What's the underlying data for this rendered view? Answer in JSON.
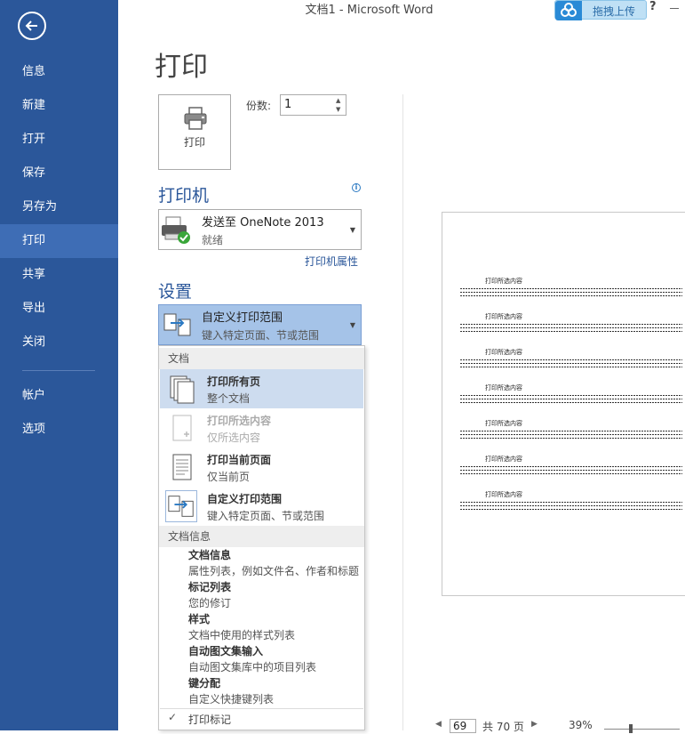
{
  "window": {
    "title": "文档1 - Microsoft Word",
    "upload_label": "拖拽上传",
    "help": "?"
  },
  "sidebar": {
    "items": [
      {
        "label": "信息"
      },
      {
        "label": "新建"
      },
      {
        "label": "打开"
      },
      {
        "label": "保存"
      },
      {
        "label": "另存为"
      },
      {
        "label": "打印",
        "active": true
      },
      {
        "label": "共享"
      },
      {
        "label": "导出"
      },
      {
        "label": "关闭"
      },
      {
        "label": "帐户"
      },
      {
        "label": "选项"
      }
    ]
  },
  "print": {
    "heading": "打印",
    "print_button": "打印",
    "copies_label": "份数:",
    "copies_value": "1"
  },
  "printer": {
    "heading": "打印机",
    "name": "发送至 OneNote 2013",
    "status": "就绪",
    "properties_link": "打印机属性"
  },
  "settings": {
    "heading": "设置",
    "selected_title": "自定义打印范围",
    "selected_sub": "键入特定页面、节或范围"
  },
  "dropdown": {
    "section1": "文档",
    "options": [
      {
        "title": "打印所有页",
        "sub": "整个文档",
        "state": "selected",
        "icon": "pages-stack-icon"
      },
      {
        "title": "打印所选内容",
        "sub": "仅所选内容",
        "state": "disabled",
        "icon": "selection-page-icon"
      },
      {
        "title": "打印当前页面",
        "sub": "仅当前页",
        "state": "normal",
        "icon": "single-page-icon"
      },
      {
        "title": "自定义打印范围",
        "sub": "键入特定页面、节或范围",
        "state": "current",
        "icon": "custom-range-icon"
      }
    ],
    "section2": "文档信息",
    "info_items": [
      {
        "title": "文档信息",
        "sub": "属性列表，例如文件名、作者和标题"
      },
      {
        "title": "标记列表",
        "sub": "您的修订"
      },
      {
        "title": "样式",
        "sub": "文档中使用的样式列表"
      },
      {
        "title": "自动图文集输入",
        "sub": "自动图文集库中的项目列表"
      },
      {
        "title": "键分配",
        "sub": "自定义快捷键列表"
      }
    ],
    "print_markup": "打印标记",
    "print_markup_checked": true
  },
  "preview": {
    "block_heading": "打印所选内容"
  },
  "pager": {
    "current_page": "69",
    "total": "共 70 页",
    "zoom": "39%"
  },
  "colors": {
    "sidebar": "#2b579a",
    "sidebar_active": "#3e6db5",
    "accent": "#2b579a",
    "selection": "#cddcef"
  }
}
